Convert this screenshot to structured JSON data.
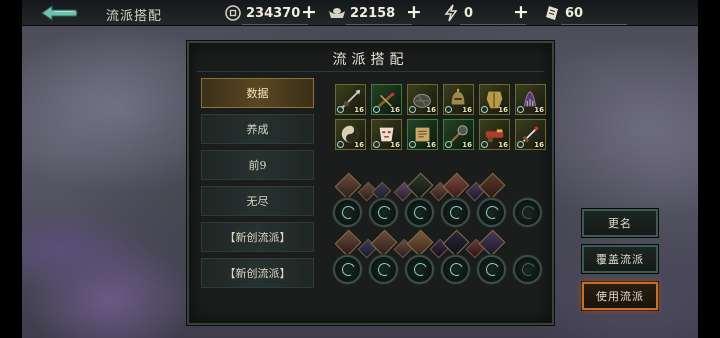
{
  "topbar": {
    "title": "流派搭配",
    "resources": [
      {
        "name": "coin",
        "icon": "coin-icon",
        "value": "234370"
      },
      {
        "name": "jade",
        "icon": "ingot-icon",
        "value": "22158"
      },
      {
        "name": "stamina",
        "icon": "lightning-icon",
        "value": "0"
      },
      {
        "name": "ticket",
        "icon": "ticket-icon",
        "value": "60"
      }
    ]
  },
  "panel": {
    "title": "流派搭配",
    "tabs": [
      {
        "label": "数据",
        "active": true
      },
      {
        "label": "养成",
        "active": false
      },
      {
        "label": "前9",
        "active": false
      },
      {
        "label": "无尽",
        "active": false
      },
      {
        "label": "【新创流派】",
        "active": false
      },
      {
        "label": "【新创流派】",
        "active": false
      }
    ],
    "equipment_level": "16",
    "equipment_count": 12
  },
  "side_buttons": {
    "rename": "更名",
    "overwrite": "覆盖流派",
    "use": "使用流派"
  },
  "colors": {
    "accent_gold": "#8d7336",
    "primary_orange": "#c8702a",
    "panel_border": "#36443c"
  }
}
